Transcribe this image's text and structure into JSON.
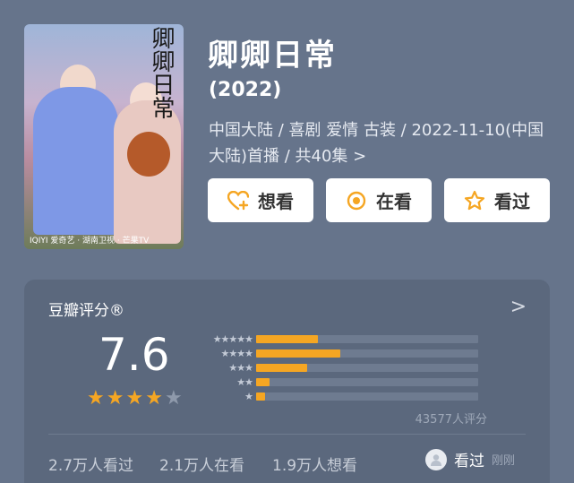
{
  "title": "卿卿日常",
  "year": "(2022)",
  "meta": "中国大陆 / 喜剧 爱情 古装 / 2022-11-10(中国大陆)首播 / 共40集 >",
  "poster": {
    "calligraphy": "卿卿日常",
    "logos": "IQIYI 爱奇艺 · 湖南卫视 · 芒果TV"
  },
  "buttons": {
    "want": "想看",
    "watching": "在看",
    "watched": "看过"
  },
  "rating": {
    "label": "豆瓣评分®",
    "chevron": ">",
    "score": "7.6",
    "stars": 4,
    "distribution": [
      {
        "stars": 5,
        "fraction": 0.28
      },
      {
        "stars": 4,
        "fraction": 0.38
      },
      {
        "stars": 3,
        "fraction": 0.23
      },
      {
        "stars": 2,
        "fraction": 0.06
      },
      {
        "stars": 1,
        "fraction": 0.04
      }
    ],
    "count": "43577人评分"
  },
  "footer": {
    "watched": "2.7万人看过",
    "watching": "2.1万人在看",
    "want": "1.9万人想看",
    "me_status": "看过",
    "me_time": "刚刚"
  },
  "colors": {
    "accent": "#f5a623",
    "background": "#66748b",
    "panel": "#5b687d"
  }
}
